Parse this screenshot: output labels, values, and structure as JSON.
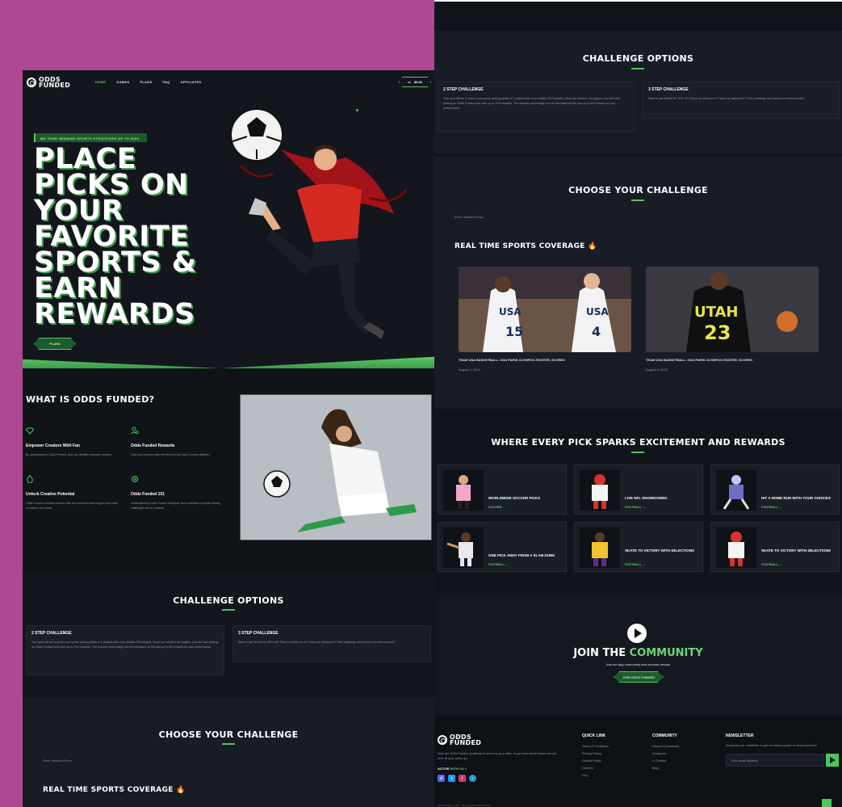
{
  "brand": {
    "logo_line1": "ODDS",
    "logo_line2": "FUNDED"
  },
  "nav": {
    "items": [
      "HOME",
      "GAMES",
      "PLANS",
      "FAQ",
      "AFFILIATES"
    ],
    "cta_label": "$0.00",
    "accent": "#4cc85a"
  },
  "hero": {
    "tagline": "WE FUND WINNING SPORTS STRATEGIES UP TO $100",
    "title": "PLACE PICKS ON YOUR FAVORITE SPORTS & EARN REWARDS",
    "button": "PLANS"
  },
  "what": {
    "title": "WHAT IS ODDS FUNDED?",
    "features": [
      {
        "icon": "diamond-icon",
        "title": "Empower Creators With Fan",
        "desc": "By participating in Odds Funded, fans can directly empower creators."
      },
      {
        "icon": "users-icon",
        "title": "Odds Funded Rewards",
        "desc": "Fans and creators alike benefit from the Odds Funded platform."
      },
      {
        "icon": "droplet-icon",
        "title": "Unlock Creative Potential",
        "desc": "Odds Funded provides creators with the resources and support they need to explore new ideas."
      },
      {
        "icon": "gear-icon",
        "title": "Odds Funded 101",
        "desc": "Understanding Odds Funded is simple: fans contribute to sports trading challenges set by creators."
      }
    ]
  },
  "challenge": {
    "title": "CHALLENGE OPTIONS",
    "cards": [
      {
        "title": "2 STEP CHALLENGE",
        "desc": "Your goal will be to prove your sports picking ability in 2 phases with very realistic ROI targets. Once you achieve the targets, you will start picking on Odds Funded and earn up to 70% rewards. The rewards percentage can be increased all the way up to 80% based on your performance."
      },
      {
        "title": "3 STEP CHALLENGE",
        "desc": "Want to get funded for 30% off? Show us what you in 3 steps by taking the 3 Step challenge and unlock a funded account."
      }
    ]
  },
  "choose": {
    "title": "CHOOSE YOUR CHALLENGE",
    "error": "Error: Network Error"
  },
  "realtime": {
    "title": "REAL TIME SPORTS COVERAGE",
    "news": [
      {
        "title": "TEAM USA BASKETBALL: 2024 PARIS OLYMPICS ROSTER, SCORES",
        "date": "August 3, 2024",
        "jersey_a": "USA",
        "num_a": "15",
        "num_b": "4"
      },
      {
        "title": "TEAM USA BASKETBALL: 2024 PARIS OLYMPICS ROSTER, SCORES",
        "date": "August 3, 2024",
        "jersey_a": "UTAH",
        "num_a": "23",
        "num_b": ""
      }
    ]
  },
  "sparks": {
    "title": "WHERE EVERY PICK SPARKS EXCITEMENT AND REWARDS",
    "cards": [
      {
        "title": "WORLDWIDE SOCCER PICKS",
        "link": "SOCCER →",
        "color": "#f3a6c9"
      },
      {
        "title": "LIVE NFL SHOWDOWNS",
        "link": "FOOTBALL →",
        "color": "#d6342c"
      },
      {
        "title": "HIT A HOME RUN WITH YOUR CHOICES",
        "link": "FOOTBALL →",
        "color": "#6c6fc4"
      },
      {
        "title": "ONE PICK AWAY FROM A SLAM DUNK",
        "link": "FOOTBALL →",
        "color": "#e8e8ee"
      },
      {
        "title": "SKATE TO VICTORY WITH SELECTIONS",
        "link": "FOOTBALL →",
        "color": "#f2c230"
      },
      {
        "title": "SKATE TO VICTORY WITH SELECTIONS",
        "link": "FOOTBALL →",
        "color": "#d6342c"
      }
    ]
  },
  "community": {
    "title_white": "JOIN THE",
    "title_green": "COMMUNITY",
    "subtitle": "Join our App community and choosec anduur",
    "button": "JOIN ODDS FUNDED"
  },
  "footer": {
    "desc": "Take the Odds Funded challenge & show us your skills. If you have what it takes we will fund all your picks up!",
    "active_white": "ACTIVE",
    "active_green": "WITH US »",
    "quick_title": "QUICK LINK",
    "quick_links": [
      "Terms & Conditions",
      "Privacy Policy",
      "Refund Policy",
      "Careers",
      "FAQ"
    ],
    "community_title": "COMMUNITY",
    "community_links": [
      "Discord Community",
      "Instagram",
      "X (Twitter)",
      "Blog"
    ],
    "newsletter_title": "NEWSLETTER",
    "newsletter_desc": "Subscribe our newsletter to get our latest update & newsconnected",
    "newsletter_placeholder": "Your email address",
    "copyright": "OddsFunded © 2024 - ALL RIGHTS RESERVED"
  }
}
